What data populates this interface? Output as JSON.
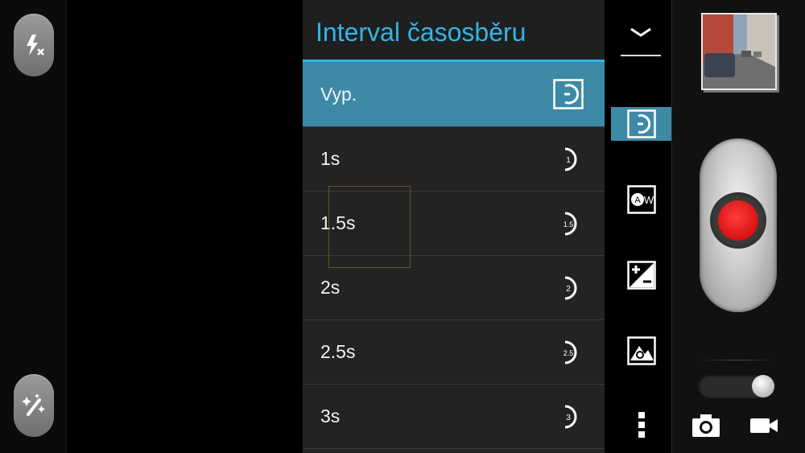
{
  "left_rail": {
    "flash_button": {
      "icon": "flash-off-icon"
    },
    "effects_button": {
      "icon": "magic-wand-icon"
    }
  },
  "menu": {
    "title": "Interval časosběru",
    "items": [
      {
        "label": "Vyp.",
        "badge": "",
        "selected": true
      },
      {
        "label": "1s",
        "badge": "1"
      },
      {
        "label": "1.5s",
        "badge": "1.5"
      },
      {
        "label": "2s",
        "badge": "2"
      },
      {
        "label": "2.5s",
        "badge": "2.5"
      },
      {
        "label": "3s",
        "badge": "3"
      }
    ]
  },
  "settings_strip": {
    "items": [
      "collapse-chevron-icon",
      "timelapse-icon",
      "white-balance-auto-icon",
      "exposure-compensation-icon",
      "scene-mode-icon",
      "more-options-icon"
    ],
    "active": "timelapse-icon",
    "wb_label": "W"
  },
  "right_panel": {
    "thumbnail": "last-capture-thumbnail",
    "shutter": "record-button",
    "mode_toggle": "photo-video-switch",
    "modes": [
      "camera-icon",
      "video-camera-icon"
    ]
  },
  "colors": {
    "accent": "#33b5e5",
    "selected_row": "#3d8aa6",
    "record": "#e00000"
  }
}
